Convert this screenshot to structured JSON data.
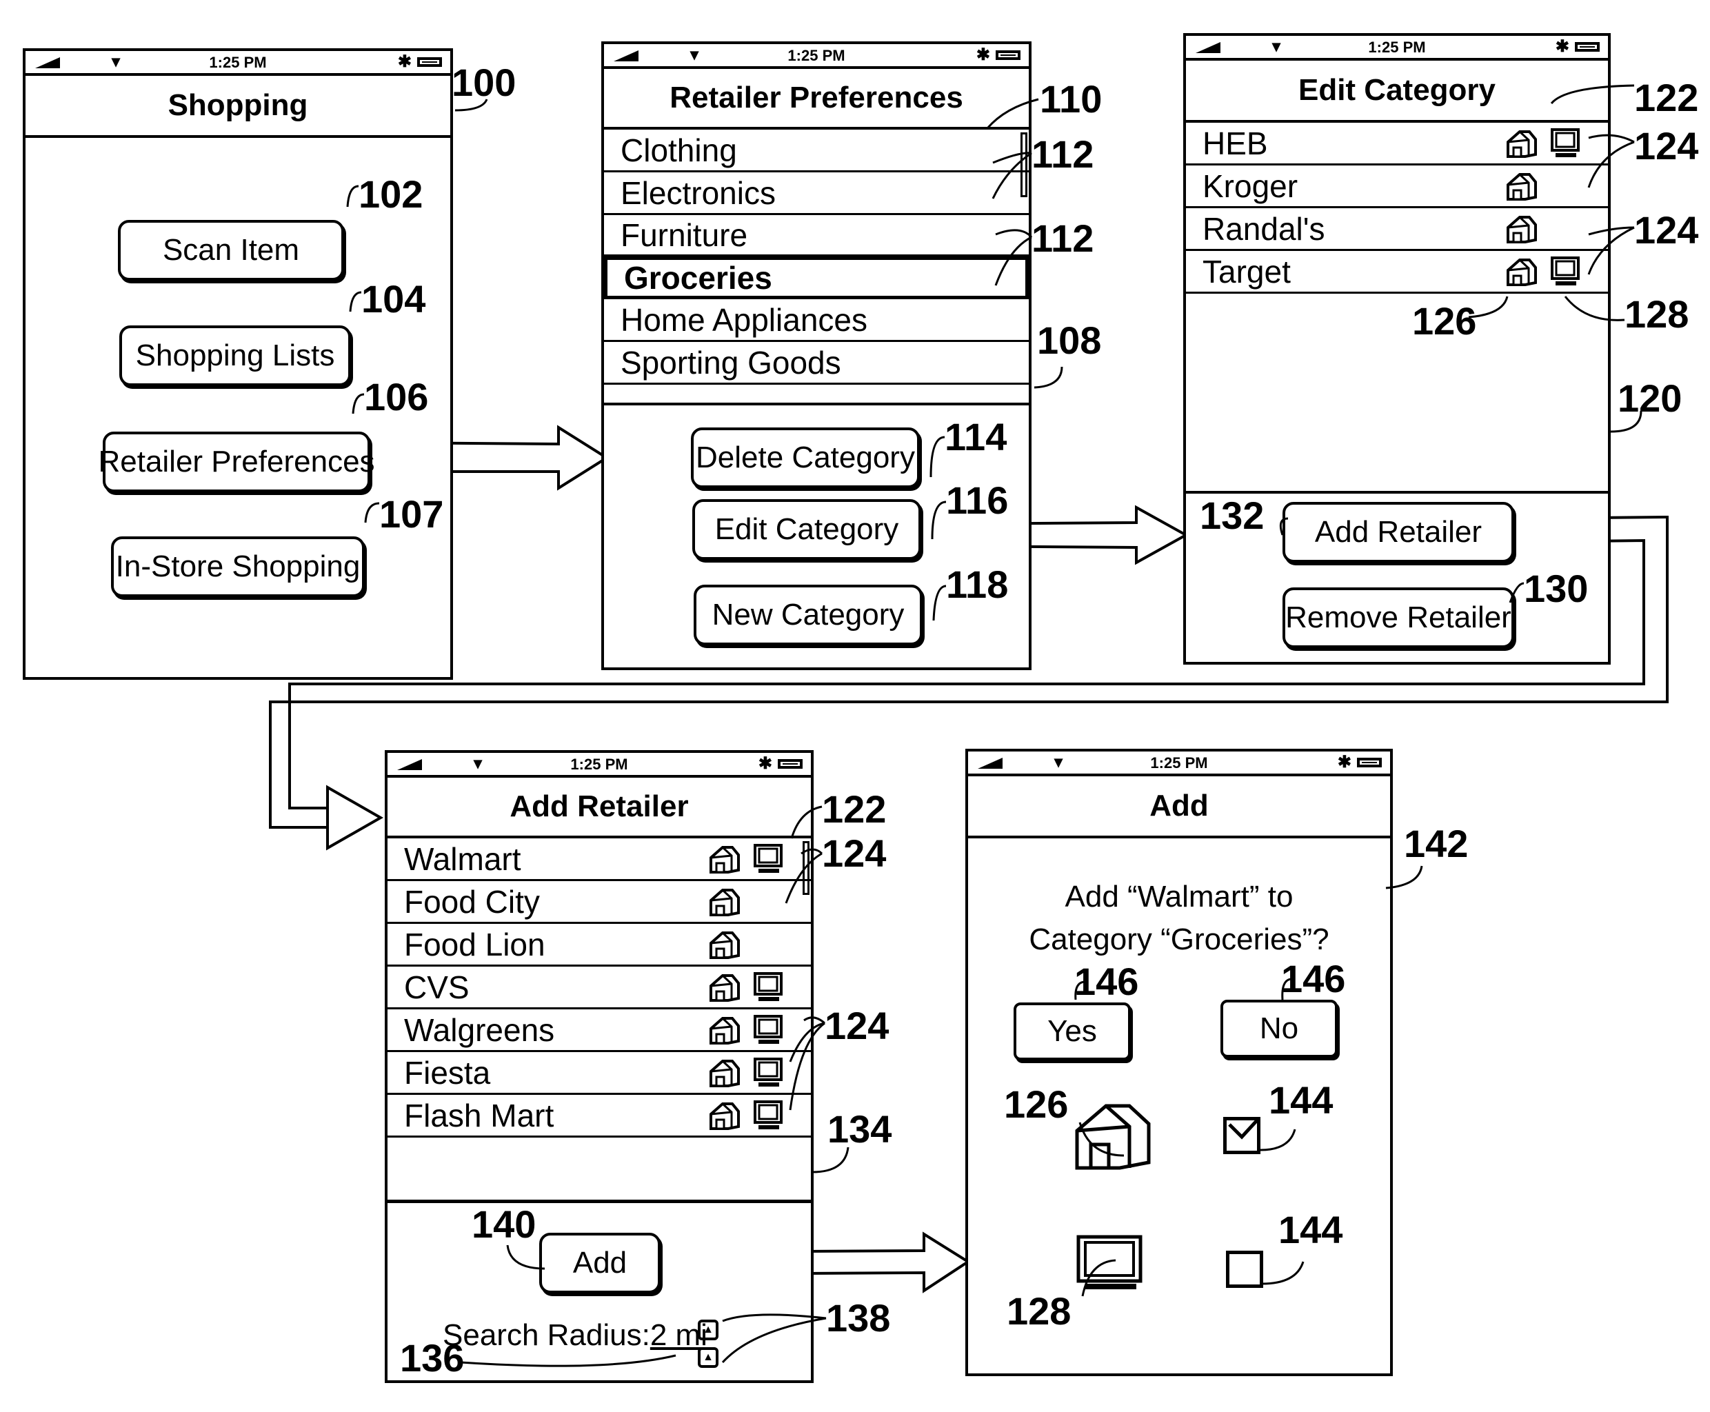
{
  "status_bar": {
    "time": "1:25 PM",
    "signal_icon": "signal-bars-icon",
    "wifi_icon": "wifi-icon",
    "bluetooth_icon": "bluetooth-icon",
    "battery_icon": "battery-icon"
  },
  "screens": {
    "shopping": {
      "ref": "100",
      "title": "Shopping",
      "buttons": [
        {
          "label": "Scan Item",
          "ref": "102"
        },
        {
          "label": "Shopping Lists",
          "ref": "104"
        },
        {
          "label": "Retailer Preferences",
          "ref": "106"
        },
        {
          "label": "In-Store Shopping",
          "ref": "107"
        }
      ]
    },
    "retailer_preferences": {
      "ref": "108",
      "title_ref": "110",
      "title": "Retailer Preferences",
      "categories": [
        {
          "label": "Clothing"
        },
        {
          "label": "Electronics"
        },
        {
          "label": "Furniture"
        },
        {
          "label": "Groceries",
          "selected": true
        },
        {
          "label": "Home Appliances"
        },
        {
          "label": "Sporting Goods"
        }
      ],
      "category_refs": [
        "112",
        "112"
      ],
      "buttons": [
        {
          "label": "Delete Category",
          "ref": "114"
        },
        {
          "label": "Edit Category",
          "ref": "116"
        },
        {
          "label": "New Category",
          "ref": "118"
        }
      ]
    },
    "edit_category": {
      "ref": "120",
      "title_ref": "122",
      "title": "Edit Category",
      "retailers": [
        {
          "name": "HEB",
          "store": true,
          "online": true
        },
        {
          "name": "Kroger",
          "store": true,
          "online": false
        },
        {
          "name": "Randal's",
          "store": true,
          "online": false
        },
        {
          "name": "Target",
          "store": true,
          "online": true
        }
      ],
      "row_refs": [
        "124",
        "124"
      ],
      "store_icon_ref": "126",
      "online_icon_ref": "128",
      "buttons": [
        {
          "label": "Add Retailer",
          "ref": "132"
        },
        {
          "label": "Remove Retailer",
          "ref": "130"
        }
      ]
    },
    "add_retailer": {
      "ref": "134",
      "title_ref": "122",
      "title": "Add Retailer",
      "retailers": [
        {
          "name": "Walmart",
          "store": true,
          "online": true
        },
        {
          "name": "Food City",
          "store": true,
          "online": false
        },
        {
          "name": "Food Lion",
          "store": true,
          "online": false
        },
        {
          "name": "CVS",
          "store": true,
          "online": true
        },
        {
          "name": "Walgreens",
          "store": true,
          "online": true
        },
        {
          "name": "Fiesta",
          "store": true,
          "online": true
        },
        {
          "name": "Flash Mart",
          "store": true,
          "online": true
        }
      ],
      "row_refs": [
        "124",
        "124"
      ],
      "add_button": {
        "label": "Add",
        "ref": "140"
      },
      "search_radius": {
        "label": "Search Radius:",
        "value": "2 mi",
        "ref": "136"
      },
      "stepper_ref": "138"
    },
    "add_confirm": {
      "ref": "142",
      "title": "Add",
      "prompt_line1": "Add “Walmart” to",
      "prompt_line2": "Category “Groceries”?",
      "yes": {
        "label": "Yes",
        "ref": "146"
      },
      "no": {
        "label": "No",
        "ref": "146"
      },
      "store_option": {
        "icon_ref": "126",
        "checked": true,
        "checkbox_ref": "144"
      },
      "online_option": {
        "icon_ref": "128",
        "checked": false,
        "checkbox_ref": "144"
      }
    }
  }
}
